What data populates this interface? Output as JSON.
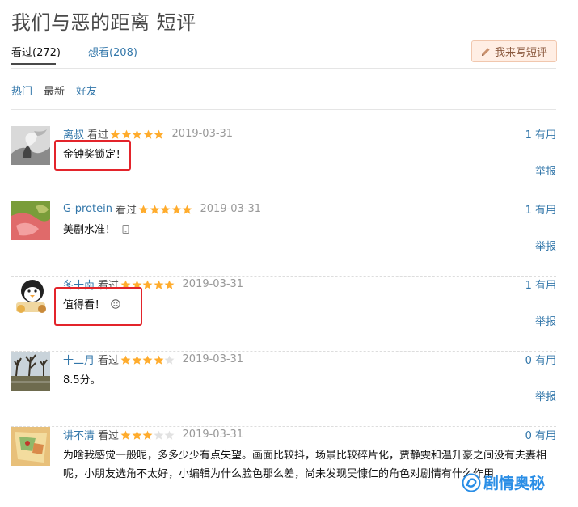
{
  "page": {
    "title": "我们与恶的距离 短评"
  },
  "tabs": [
    {
      "label": "看过(272)"
    },
    {
      "label": "想看(208)"
    }
  ],
  "write_button": {
    "label": "我来写短评"
  },
  "filters": [
    {
      "label": "热门"
    },
    {
      "label": "最新"
    },
    {
      "label": "好友"
    }
  ],
  "comments": [
    {
      "user": "离叔",
      "status": "看过",
      "rating": 5,
      "date": "2019-03-31",
      "useful_count": "1",
      "useful_label": "有用",
      "text": "金钟奖锁定！",
      "report": "举报"
    },
    {
      "user": "G-protein",
      "status": "看过",
      "rating": 5,
      "date": "2019-03-31",
      "useful_count": "1",
      "useful_label": "有用",
      "text": "美剧水准！",
      "report": "举报"
    },
    {
      "user": "冬十南",
      "status": "看过",
      "rating": 5,
      "date": "2019-03-31",
      "useful_count": "1",
      "useful_label": "有用",
      "text": "值得看！",
      "report": "举报"
    },
    {
      "user": "十二月",
      "status": "看过",
      "rating": 4,
      "date": "2019-03-31",
      "useful_count": "0",
      "useful_label": "有用",
      "text": "8.5分。",
      "report": "举报"
    },
    {
      "user": "讲不清",
      "status": "看过",
      "rating": 3,
      "date": "2019-03-31",
      "useful_count": "0",
      "useful_label": "有用",
      "text": "为啥我感觉一般呢，多多少少有点失望。画面比较抖，场景比较碎片化，贾静雯和温升豪之间没有夫妻相呢，小朋友选角不太好，小编辑为什么脸色那么差，尚未发现吴慷仁的角色对剧情有什么作用"
    }
  ],
  "watermark": {
    "text": "剧情奥秘"
  },
  "colors": {
    "link": "#3377aa",
    "star": "#ffac2d",
    "highlight": "#e3242b"
  }
}
